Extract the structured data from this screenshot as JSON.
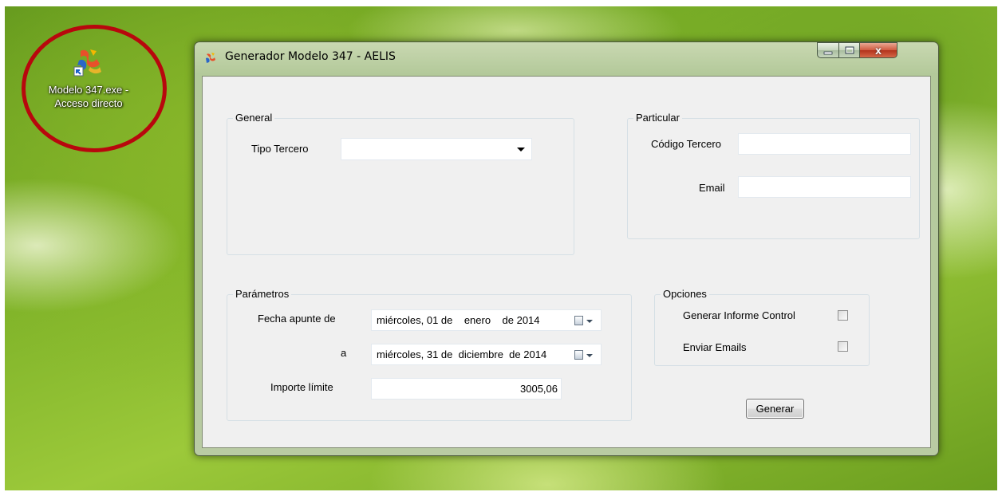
{
  "desktop": {
    "shortcut_label_line1": "Modelo 347.exe -",
    "shortcut_label_line2": "Acceso directo",
    "highlight_color": "#b8070d"
  },
  "window": {
    "title": "Generador Modelo 347 - AELIS",
    "caption_buttons": {
      "minimize_icon": "minimize-icon",
      "maximize_icon": "maximize-icon",
      "close_icon": "close-icon",
      "close_glyph": "x"
    }
  },
  "general": {
    "title": "General",
    "tipo_tercero_label": "Tipo Tercero",
    "tipo_tercero_value": ""
  },
  "particular": {
    "title": "Particular",
    "codigo_tercero_label": "Código Tercero",
    "codigo_tercero_value": "",
    "email_label": "Email",
    "email_value": ""
  },
  "parametros": {
    "title": "Parámetros",
    "fecha_apunte_label": "Fecha apunte de",
    "fecha_desde": "miércoles, 01 de    enero    de 2014",
    "a_label": "a",
    "fecha_hasta": "miércoles, 31 de  diciembre  de 2014",
    "importe_label": "Importe límite",
    "importe_value": "3005,06"
  },
  "opciones": {
    "title": "Opciones",
    "informe_label": "Generar Informe Control",
    "informe_checked": false,
    "emails_label": "Enviar Emails",
    "emails_checked": false
  },
  "actions": {
    "generar_label": "Generar"
  }
}
